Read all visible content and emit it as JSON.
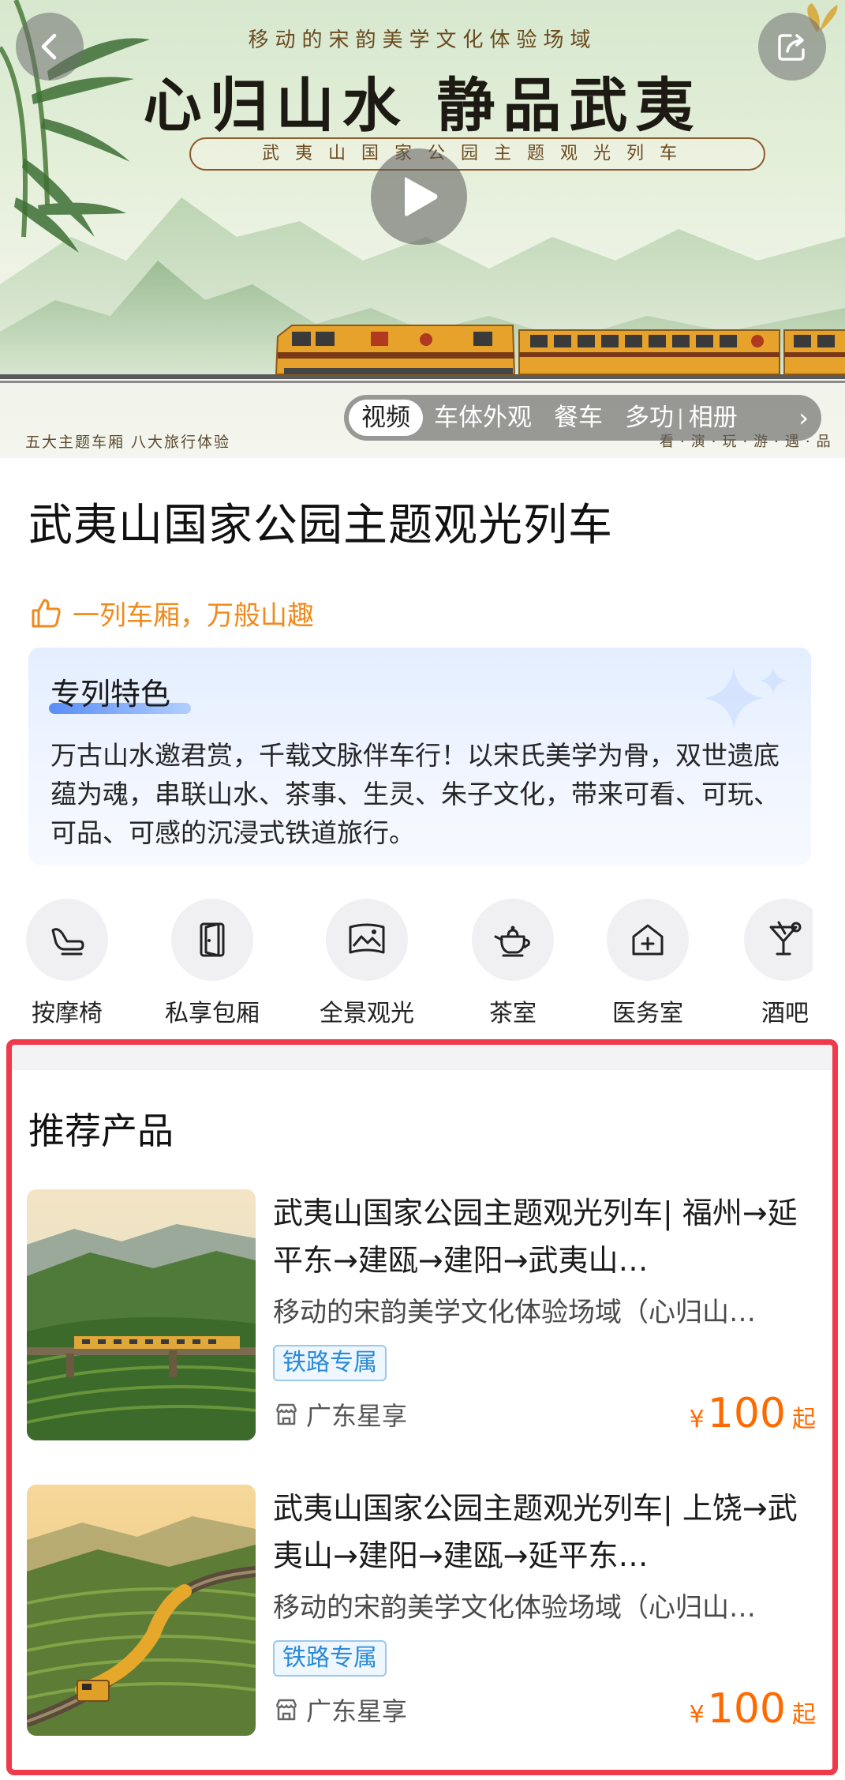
{
  "hero": {
    "subtitle": "移动的宋韵美学文化体验场域",
    "title": "心归山水 静品武夷",
    "banner": "武夷山国家公园主题观光列车",
    "left_caption": "五大主题车厢 八大旅行体验",
    "right_caption": "看·演·玩·游·遇·品",
    "back_icon": "back-arrow-icon",
    "share_icon": "share-icon",
    "play_icon": "play-icon",
    "media_tabs": [
      {
        "label": "视频",
        "active": true
      },
      {
        "label": "车体外观",
        "active": false
      },
      {
        "label": "餐车",
        "active": false
      },
      {
        "label": "多功",
        "active": false
      },
      {
        "label": "相册",
        "active": false
      }
    ],
    "media_more_icon": "chevron-right-icon"
  },
  "product": {
    "title": "武夷山国家公园主题观光列车",
    "slogan": "一列车厢，万般山趣",
    "slogan_icon": "thumbs-up-icon",
    "slogan_color": "#f08a1c"
  },
  "feature": {
    "heading": "专列特色",
    "body": "万古山水邀君赏，千载文脉伴车行！以宋氏美学为骨，双世遗底蕴为魂，串联山水、茶事、生灵、朱子文化，带来可看、可玩、可品、可感的沉浸式铁道旅行。"
  },
  "amenities": [
    {
      "label": "按摩椅",
      "icon": "massage-chair-icon"
    },
    {
      "label": "私享包厢",
      "icon": "door-icon"
    },
    {
      "label": "全景观光",
      "icon": "panorama-icon"
    },
    {
      "label": "茶室",
      "icon": "teapot-icon"
    },
    {
      "label": "医务室",
      "icon": "medical-house-icon"
    },
    {
      "label": "酒吧",
      "icon": "cocktail-icon"
    }
  ],
  "recommended": {
    "heading": "推荐产品",
    "items": [
      {
        "title": "武夷山国家公园主题观光列车| 福州→延平东→建瓯→建阳→武夷山…",
        "desc": "移动的宋韵美学文化体验场域（心归山…",
        "tag": "铁路专属",
        "seller": "广东星享",
        "currency": "¥",
        "price": "100",
        "price_suffix": "起"
      },
      {
        "title": "武夷山国家公园主题观光列车| 上饶→武夷山→建阳→建瓯→延平东…",
        "desc": "移动的宋韵美学文化体验场域（心归山…",
        "tag": "铁路专属",
        "seller": "广东星享",
        "currency": "¥",
        "price": "100",
        "price_suffix": "起"
      }
    ]
  },
  "colors": {
    "accent_orange": "#ff6a00",
    "highlight_frame": "#ee3a4a",
    "tag_blue": "#2a8ad6",
    "train_yellow": "#e6a22a"
  }
}
